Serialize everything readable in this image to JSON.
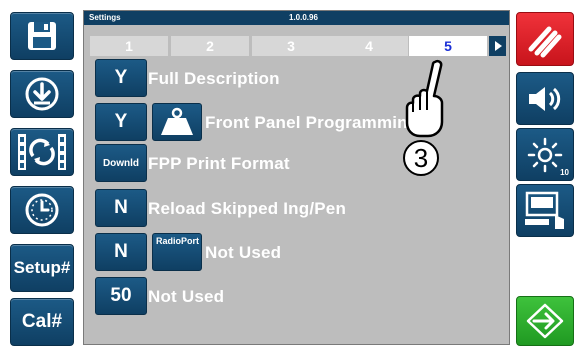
{
  "window": {
    "title": "Settings",
    "version": "1.0.0.96"
  },
  "tabs": [
    {
      "label": "1",
      "active": false
    },
    {
      "label": "2",
      "active": false
    },
    {
      "label": "3",
      "active": false
    },
    {
      "label": "4",
      "active": false
    },
    {
      "label": "5",
      "active": true
    }
  ],
  "left_buttons": {
    "save_icon": "save-icon",
    "download_icon": "download-icon",
    "sync_icon": "sync-icon",
    "clock_icon": "clock-icon",
    "setup_label": "Setup#",
    "cal_label": "Cal#"
  },
  "right_buttons": {
    "stop_icon": "stop-icon",
    "volume_icon": "volume-icon",
    "brightness_icon": "brightness-icon",
    "brightness_level": "10",
    "print_icon": "printer-icon",
    "enter_icon": "enter-icon"
  },
  "settings": [
    {
      "value": "Y",
      "label": "Full Description"
    },
    {
      "value": "Y",
      "label": "Front Panel Programming",
      "icon": "weight-icon"
    },
    {
      "value": "Downld",
      "label": "FPP Print Format"
    },
    {
      "value": "N",
      "label": "Reload Skipped Ing/Pen"
    },
    {
      "value": "N",
      "label": "Not Used",
      "button_label": "RadioPort"
    },
    {
      "value": "50",
      "label": "Not Used"
    }
  ],
  "annotation": {
    "step": "3",
    "pointer_icon": "hand-pointer-icon"
  },
  "colors": {
    "button_blue": "#0f3f63",
    "panel_gray": "#bdbdbd",
    "stop_red": "#e0202a",
    "enter_green": "#2faf2e",
    "active_tab_text": "#1a2fd6"
  }
}
